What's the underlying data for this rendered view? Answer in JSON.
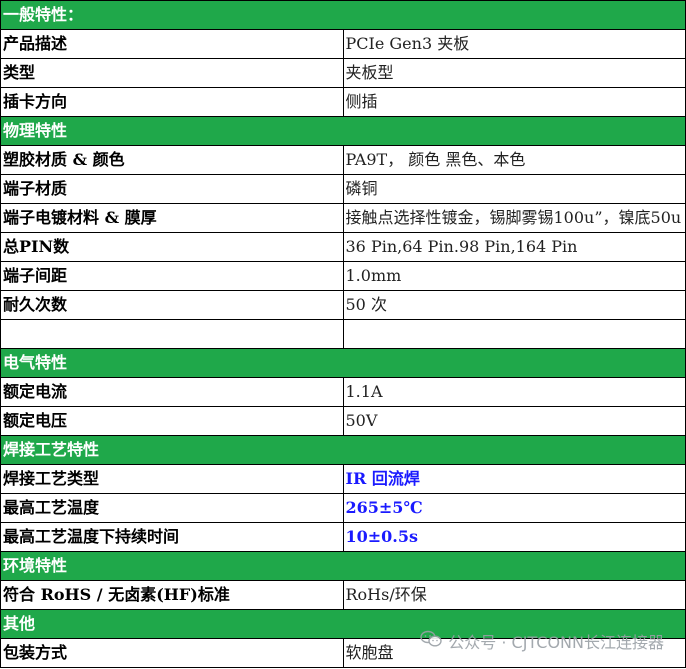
{
  "sections": [
    {
      "title": "一般特性：",
      "rows": [
        {
          "key": "产品描述",
          "value": "PCIe Gen3 夹板"
        },
        {
          "key": "类型",
          "value": "夹板型"
        },
        {
          "key": "插卡方向",
          "value": "侧插"
        }
      ]
    },
    {
      "title": "物理特性",
      "rows": [
        {
          "key": "塑胶材质 & 颜色",
          "value": "PA9T， 颜色 黑色、本色"
        },
        {
          "key": "端子材质",
          "value": "磷铜"
        },
        {
          "key": "端子电镀材料 & 膜厚",
          "value": "接触点选择性镀金，锡脚雾锡100u”，镍底50u"
        },
        {
          "key": "总PIN数",
          "value": "36 Pin,64 Pin.98 Pin,164 Pin"
        },
        {
          "key": "端子间距",
          "value": "1.0mm"
        },
        {
          "key": "耐久次数",
          "value": "50 次"
        },
        {
          "key": "",
          "value": ""
        }
      ]
    },
    {
      "title": "电气特性",
      "rows": [
        {
          "key": "额定电流",
          "value": "1.1A"
        },
        {
          "key": "额定电压",
          "value": "50V"
        }
      ]
    },
    {
      "title": "焊接工艺特性",
      "rows": [
        {
          "key": "焊接工艺类型",
          "value": "IR 回流焊",
          "highlight": true
        },
        {
          "key": "最高工艺温度",
          "value": "265±5℃",
          "highlight": true
        },
        {
          "key": "最高工艺温度下持续时间",
          "value": "10±0.5s",
          "highlight": true
        }
      ]
    },
    {
      "title": "环境特性",
      "rows": [
        {
          "key": "符合 RoHS / 无卤素(HF)标准",
          "value": "RoHs/环保"
        }
      ]
    },
    {
      "title": "其他",
      "rows": [
        {
          "key": "包装方式",
          "value": "软胞盘"
        }
      ]
    }
  ],
  "watermark": {
    "icon": "wechat-icon",
    "text": "公众号 · CJTCONN长江连接器"
  },
  "colors": {
    "section_bg": "#1fa84a",
    "section_text": "#ffffff",
    "highlight_value": "#1a1aff"
  }
}
